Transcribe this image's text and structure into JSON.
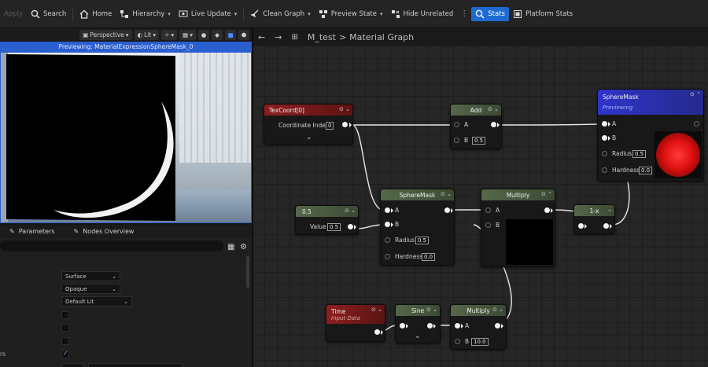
{
  "toolbar": {
    "apply": "Apply",
    "search": "Search",
    "home": "Home",
    "hierarchy": "Hierarchy",
    "live_update": "Live Update",
    "clean_graph": "Clean Graph",
    "preview_state": "Preview State",
    "hide_unrelated": "Hide Unrelated",
    "stats": "Stats",
    "platform_stats": "Platform Stats"
  },
  "viewport": {
    "perspective": "Perspective",
    "lit": "Lit",
    "caption": "Previewing: MaterialExpressionSphereMask_0"
  },
  "panel_tabs": {
    "parameters": "Parameters",
    "nodes_overview": "Nodes Overview"
  },
  "details": {
    "domain_value": "Surface",
    "blend_mode_value": "Opaque",
    "shading_model_value": "Default Lit",
    "row_label_fragment": "rs"
  },
  "graph": {
    "breadcrumb_asset": "M_test",
    "breadcrumb_sep": ">",
    "breadcrumb_graph": "Material Graph",
    "nodes": {
      "texcoord": {
        "title": "TexCoord[0]",
        "pin": "Coordinate Index",
        "value": "0"
      },
      "add": {
        "title": "Add",
        "a": "A",
        "b": "B",
        "b_value": "0.5"
      },
      "spheremask_main": {
        "title": "SphereMask",
        "subtitle": "Previewing",
        "a": "A",
        "b": "B",
        "radius": "Radius",
        "radius_value": "0.5",
        "hardness": "Hardness",
        "hardness_value": "0.0"
      },
      "constant": {
        "title": "0.5",
        "pin": "Value",
        "value": "0.5"
      },
      "spheremask2": {
        "title": "SphereMask",
        "a": "A",
        "b": "B",
        "radius": "Radius",
        "radius_value": "0.5",
        "hardness": "Hardness",
        "hardness_value": "0.0"
      },
      "multiply1": {
        "title": "Multiply",
        "a": "A",
        "b": "B"
      },
      "oneminus": {
        "title": "1-x"
      },
      "time": {
        "title": "Time",
        "subtitle": "Input Data"
      },
      "sine": {
        "title": "Sine"
      },
      "multiply2": {
        "title": "Multiply",
        "a": "A",
        "b": "B",
        "b_value": "10.0"
      }
    }
  },
  "colors": {
    "accent": "#1d6bd1",
    "caption_bg": "#2a5fcf",
    "node_red": "#8e1e1e",
    "node_green": "#55684a",
    "node_blue": "#2f34c9",
    "preview_sphere": "#e01010"
  }
}
